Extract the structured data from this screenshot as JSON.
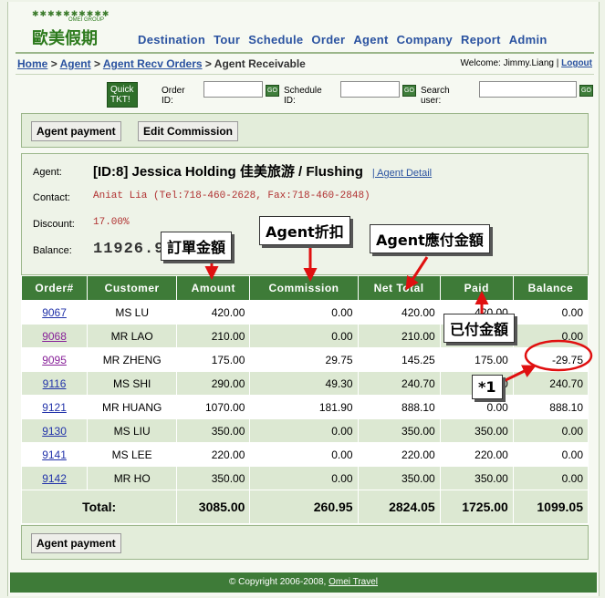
{
  "brand": {
    "logo_text": "歐美假期",
    "group_text": "OMEI GROUP"
  },
  "nav": [
    "Destination",
    "Tour",
    "Schedule",
    "Order",
    "Agent",
    "Company",
    "Report",
    "Admin"
  ],
  "breadcrumb": {
    "items": [
      "Home",
      "Agent",
      "Agent Recv Orders"
    ],
    "current": "Agent Receivable",
    "sep": ">"
  },
  "welcome": {
    "text": "Welcome: Jimmy.Liang |",
    "logout": "Logout"
  },
  "search": {
    "quick": "Quick TKT!",
    "order_label": "Order ID:",
    "schedule_label": "Schedule ID:",
    "user_label": "Search user:",
    "go": "GO"
  },
  "toolbar": {
    "agent_payment": "Agent payment",
    "edit_commission": "Edit Commission"
  },
  "agent": {
    "agent_label": "Agent:",
    "name": "[ID:8]  Jessica Holding 佳美旅游  / Flushing",
    "detail_link": "| Agent Detail",
    "contact_label": "Contact:",
    "contact": "Aniat Lia  (Tel:718-460-2628, Fax:718-460-2848)",
    "discount_label": "Discount:",
    "discount": "17.00%",
    "balance_label": "Balance:",
    "balance": "11926.9"
  },
  "table": {
    "headers": [
      "Order#",
      "Customer",
      "Amount",
      "Commission",
      "Net Total",
      "Paid",
      "Balance"
    ],
    "rows": [
      {
        "order": "9067",
        "customer": "MS LU",
        "amount": "420.00",
        "commission": "0.00",
        "net": "420.00",
        "paid": "420.00",
        "balance": "0.00"
      },
      {
        "order": "9068",
        "customer": "MR LAO",
        "amount": "210.00",
        "commission": "0.00",
        "net": "210.00",
        "paid": "210.00",
        "balance": "0.00"
      },
      {
        "order": "9095",
        "customer": "MR ZHENG",
        "amount": "175.00",
        "commission": "29.75",
        "net": "145.25",
        "paid": "175.00",
        "balance": "-29.75"
      },
      {
        "order": "9116",
        "customer": "MS SHI",
        "amount": "290.00",
        "commission": "49.30",
        "net": "240.70",
        "paid": "0.00",
        "balance": "240.70"
      },
      {
        "order": "9121",
        "customer": "MR HUANG",
        "amount": "1070.00",
        "commission": "181.90",
        "net": "888.10",
        "paid": "0.00",
        "balance": "888.10"
      },
      {
        "order": "9130",
        "customer": "MS LIU",
        "amount": "350.00",
        "commission": "0.00",
        "net": "350.00",
        "paid": "350.00",
        "balance": "0.00"
      },
      {
        "order": "9141",
        "customer": "MS LEE",
        "amount": "220.00",
        "commission": "0.00",
        "net": "220.00",
        "paid": "220.00",
        "balance": "0.00"
      },
      {
        "order": "9142",
        "customer": "MR HO",
        "amount": "350.00",
        "commission": "0.00",
        "net": "350.00",
        "paid": "350.00",
        "balance": "0.00"
      }
    ],
    "total": {
      "label": "Total:",
      "amount": "3085.00",
      "commission": "260.95",
      "net": "2824.05",
      "paid": "1725.00",
      "balance": "1099.05"
    }
  },
  "bottom": {
    "agent_payment": "Agent payment"
  },
  "footer": {
    "text": "© Copyright 2006-2008,",
    "link": "Omei Travel"
  },
  "annotations": {
    "amount": "訂單金額",
    "commission": "Agent折扣",
    "net_total": "Agent應付金額",
    "paid": "已付金額",
    "note": "*1",
    "color": "#e01010"
  }
}
